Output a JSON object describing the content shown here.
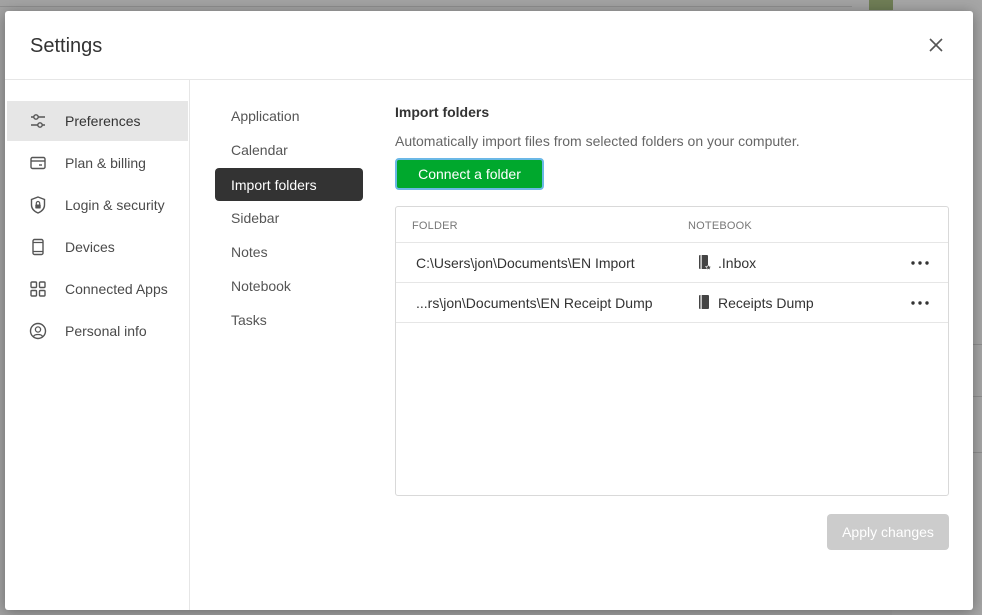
{
  "modal": {
    "title": "Settings"
  },
  "left_nav": {
    "items": [
      {
        "label": "Preferences",
        "icon": "sliders-icon",
        "active": true
      },
      {
        "label": "Plan & billing",
        "icon": "credit-card-icon",
        "active": false
      },
      {
        "label": "Login & security",
        "icon": "shield-lock-icon",
        "active": false
      },
      {
        "label": "Devices",
        "icon": "device-icon",
        "active": false
      },
      {
        "label": "Connected Apps",
        "icon": "apps-grid-icon",
        "active": false
      },
      {
        "label": "Personal info",
        "icon": "user-circle-icon",
        "active": false
      }
    ]
  },
  "sub_nav": {
    "items": [
      {
        "label": "Application",
        "active": false
      },
      {
        "label": "Calendar",
        "active": false
      },
      {
        "label": "Import folders",
        "active": true
      },
      {
        "label": "Sidebar",
        "active": false
      },
      {
        "label": "Notes",
        "active": false
      },
      {
        "label": "Notebook",
        "active": false
      },
      {
        "label": "Tasks",
        "active": false
      }
    ]
  },
  "content": {
    "title": "Import folders",
    "description": "Automatically import files from selected folders on your computer.",
    "connect_button": "Connect a folder",
    "apply_button": "Apply changes",
    "table": {
      "headers": {
        "folder": "FOLDER",
        "notebook": "NOTEBOOK"
      },
      "rows": [
        {
          "folder": "C:\\Users\\jon\\Documents\\EN Import",
          "notebook": ".Inbox",
          "notebook_icon": "default-notebook-icon"
        },
        {
          "folder": "...rs\\jon\\Documents\\EN Receipt Dump",
          "notebook": "Receipts Dump",
          "notebook_icon": "notebook-icon"
        }
      ]
    }
  },
  "colors": {
    "accent_green": "#00a82d",
    "active_sub_bg": "#333333",
    "active_nav_bg": "#e6e6e6",
    "disabled_button": "#cccccc"
  }
}
